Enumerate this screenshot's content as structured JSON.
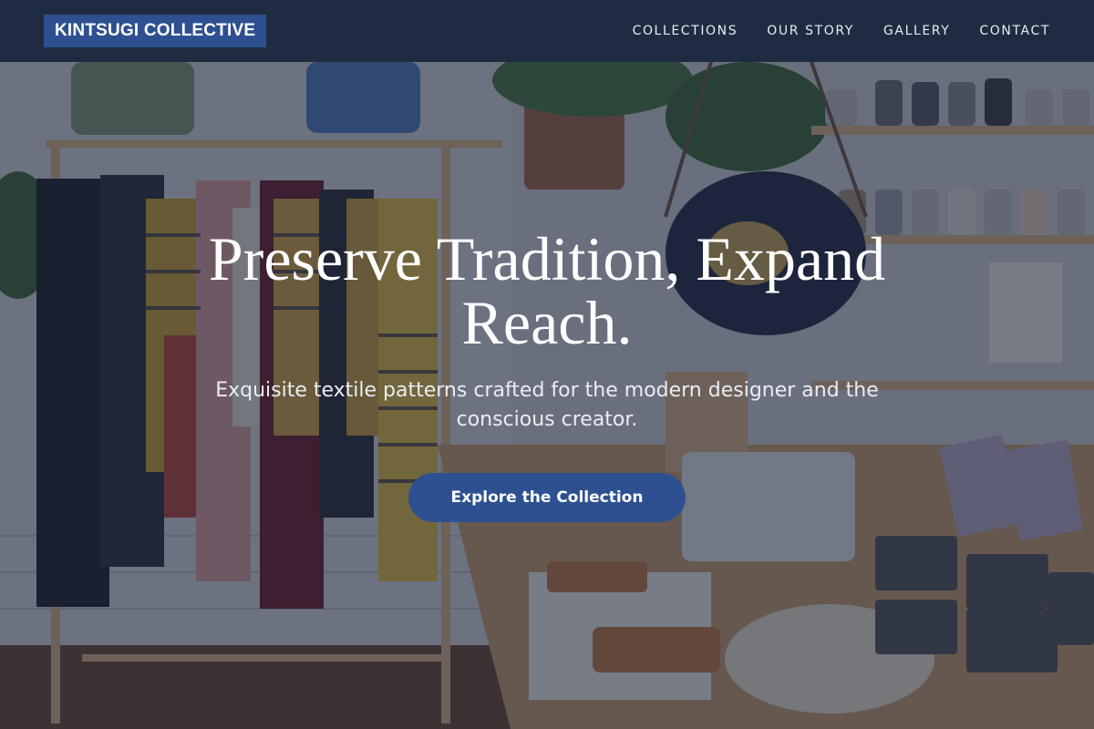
{
  "brand": {
    "logo_text": "KINTSUGI COLLECTIVE"
  },
  "nav": {
    "items": [
      {
        "label": "COLLECTIONS"
      },
      {
        "label": "OUR STORY"
      },
      {
        "label": "GALLERY"
      },
      {
        "label": "CONTACT"
      }
    ]
  },
  "hero": {
    "headline": "Preserve Tradition, Expand Reach.",
    "subhead": "Exquisite textile patterns crafted for the modern designer and the conscious creator.",
    "cta_label": "Explore the Collection"
  },
  "colors": {
    "header_bg": "#1f2b40",
    "accent": "#2e5090",
    "overlay": "rgba(22,30,50,0.55)"
  }
}
